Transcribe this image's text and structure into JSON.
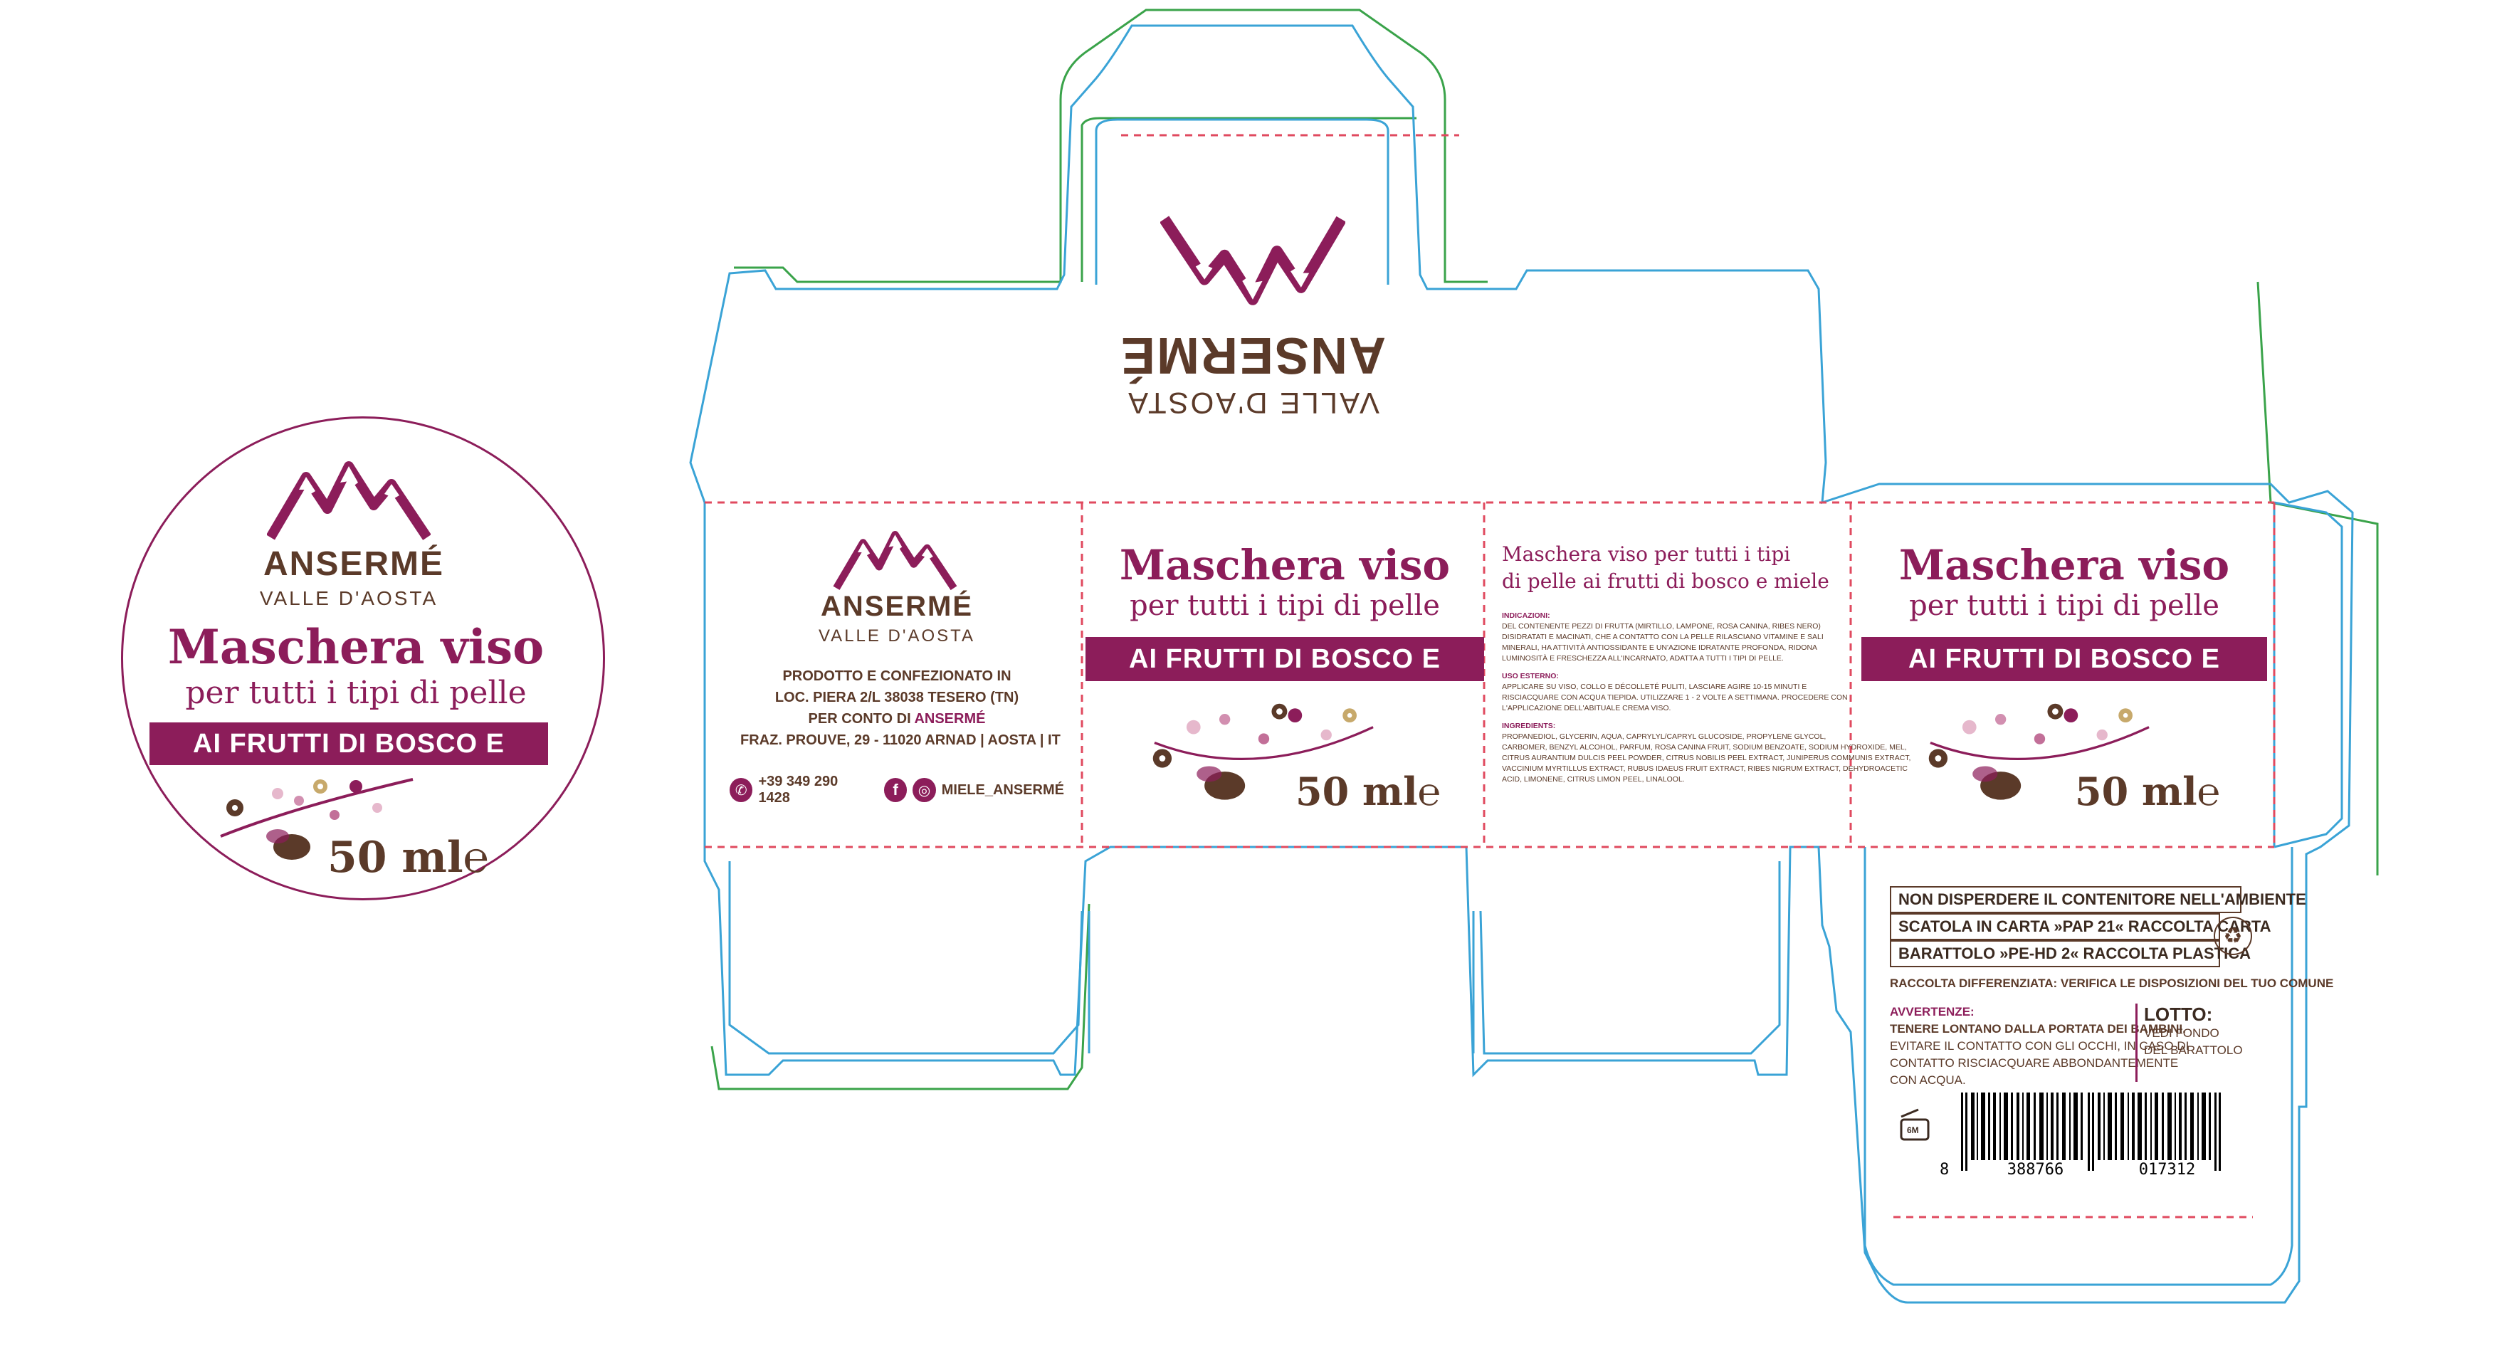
{
  "brand": {
    "name": "ANSERMÉ",
    "subtitle": "VALLE D'AOSTA"
  },
  "product": {
    "title": "Maschera viso",
    "subtitle": "per tutti i tipi di pelle",
    "band": "AI FRUTTI DI BOSCO E MIELE",
    "volume": "50 ml",
    "volume_mark": "℮"
  },
  "producer": {
    "lines": [
      "PRODOTTO E CONFEZIONATO IN",
      "LOC. PIERA 2/L 38038 TESERO (TN)",
      "PER CONTO DI",
      "FRAZ. PROUVE, 29 - 11020 ARNAD | AOSTA | IT"
    ],
    "per_conto_brand": "ANSERMÉ",
    "phone": "+39 349 290 1428",
    "social": "MIELE_ANSERMÉ"
  },
  "info": {
    "title_line1": "Maschera viso per tutti i tipi",
    "title_line2": "di pelle ai frutti di bosco e miele",
    "indicazioni_label": "INDICAZIONI:",
    "indicazioni": [
      "DEL CONTENENTE PEZZI DI FRUTTA (MIRTILLO, LAMPONE, ROSA CANINA, RIBES NERO)",
      "DISIDRATATI E MACINATI, CHE A CONTATTO CON LA PELLE RILASCIANO VITAMINE E SALI",
      "MINERALI, HA ATTIVITÀ ANTIOSSIDANTE E UN'AZIONE IDRATANTE PROFONDA, RIDONA",
      "LUMINOSITÀ E FRESCHEZZA ALL'INCARNATO, ADATTA A TUTTI I TIPI DI PELLE."
    ],
    "uso_label": "USO ESTERNO:",
    "uso": [
      "APPLICARE SU VISO, COLLO E DÉCOLLETÉ PULITI, LASCIARE AGIRE 10-15 MINUTI E",
      "RISCIACQUARE CON ACQUA TIEPIDA. UTILIZZARE 1 - 2 VOLTE A SETTIMANA. PROCEDERE CON",
      "L'APPLICAZIONE DELL'ABITUALE CREMA VISO."
    ],
    "ingredienti_label": "INGREDIENTS:",
    "ingredienti": [
      "PROPANEDIOL, GLYCERIN, AQUA, CAPRYLYL/CAPRYL GLUCOSIDE, PROPYLENE GLYCOL,",
      "CARBOMER, BENZYL ALCOHOL, PARFUM, ROSA CANINA FRUIT, SODIUM BENZOATE, SODIUM HYDROXIDE, MEL,",
      "CITRUS AURANTIUM DULCIS PEEL POWDER, CITRUS NOBILIS PEEL EXTRACT, JUNIPERUS COMMUNIS EXTRACT,",
      "VACCINIUM MYRTILLUS EXTRACT, RUBUS IDAEUS FRUIT EXTRACT, RIBES NIGRUM EXTRACT, DEHYDROACETIC",
      "ACID, LIMONENE, CITRUS LIMON PEEL, LINALOOL."
    ]
  },
  "back": {
    "env1": "NON DISPERDERE IL CONTENITORE NELL'AMBIENTE",
    "env2": "SCATOLA IN CARTA »PAP 21« RACCOLTA CARTA",
    "env3": "BARATTOLO »PE-HD 2« RACCOLTA PLASTICA",
    "raccolta": "RACCOLTA DIFFERENZIATA: VERIFICA LE DISPOSIZIONI DEL TUO COMUNE",
    "avvertenze_label": "AVVERTENZE:",
    "avvertenze": [
      "TENERE LONTANO DALLA PORTATA DEI BAMBINI.",
      "EVITARE IL CONTATTO CON GLI OCCHI, IN CASO DI",
      "CONTATTO RISCIACQUARE ABBONDANTEMENTE",
      "CON ACQUA."
    ],
    "lotto_label": "LOTTO:",
    "lotto": [
      "VEDI FONDO",
      "DEL BARATTOLO"
    ],
    "pao": "6M",
    "barcode": [
      "8",
      "388766",
      "017312"
    ]
  },
  "colors": {
    "brand": "#8c1d5a",
    "brown": "#5b3a29",
    "cut": "#3aa3d6",
    "fold": "#e04a5f",
    "bleed": "#3aa34a"
  }
}
